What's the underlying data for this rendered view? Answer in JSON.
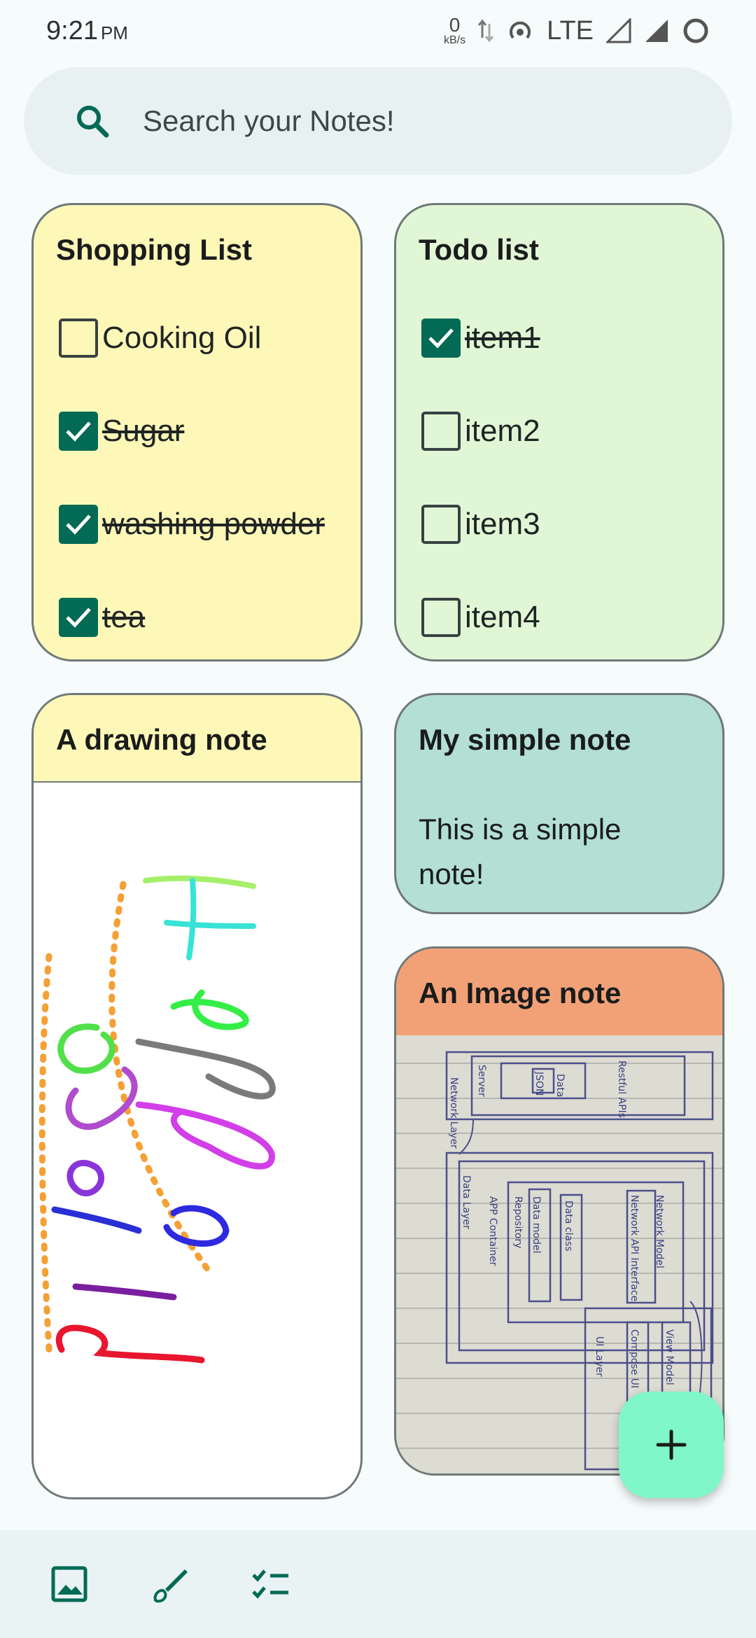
{
  "status_bar": {
    "time": "9:21",
    "ampm": "PM",
    "net_speed": "0",
    "net_unit": "kB/s",
    "network": "LTE"
  },
  "search": {
    "placeholder": "Search your Notes!"
  },
  "notes": {
    "shopping": {
      "title": "Shopping List",
      "items": [
        {
          "label": "Cooking Oil",
          "checked": false
        },
        {
          "label": "Sugar",
          "checked": true
        },
        {
          "label": "washing powder",
          "checked": true
        },
        {
          "label": "tea",
          "checked": true
        }
      ]
    },
    "todo": {
      "title": "Todo list",
      "items": [
        {
          "label": "item1",
          "checked": true
        },
        {
          "label": "item2",
          "checked": false
        },
        {
          "label": "item3",
          "checked": false
        },
        {
          "label": "item4",
          "checked": false
        }
      ]
    },
    "drawing": {
      "title": "A drawing note"
    },
    "simple": {
      "title": "My simple note",
      "body": "This is a simple note!"
    },
    "image": {
      "title": "An Image note",
      "photo_text": [
        "Network Layer",
        "Server",
        "Restful APIs",
        "Data",
        "JSON",
        "Data Layer",
        "APP Container",
        "Repository",
        "Data model",
        "Data class",
        "Network API Interface",
        "Network Model",
        "UI Layer",
        "Compose UI",
        "View Model"
      ]
    }
  },
  "colors": {
    "accent": "#036a55",
    "fab": "#7ff7c9",
    "yellow_card": "#fef8b8",
    "green_card": "#e1f6d5",
    "teal_card": "#b3dfd4",
    "image_header": "#f2a177"
  },
  "icons": {
    "search": "search-icon",
    "add": "add-icon",
    "image": "image-icon",
    "brush": "brush-icon",
    "checklist": "checklist-icon"
  }
}
